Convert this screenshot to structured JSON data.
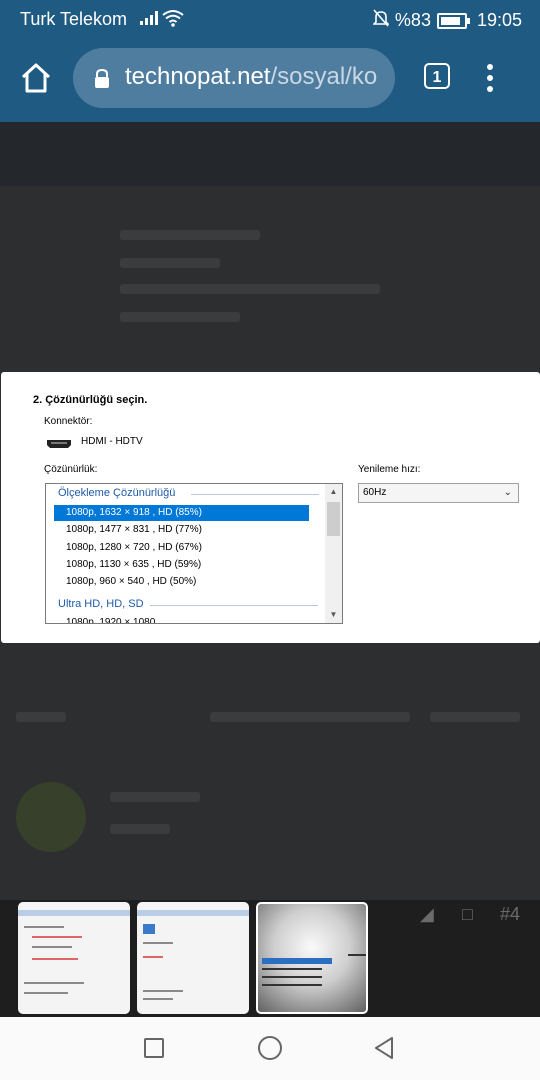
{
  "status_bar": {
    "carrier": "Turk Telekom",
    "battery": "%83",
    "time": "19:05"
  },
  "browser": {
    "url_domain": "technopat.net",
    "url_path": "/sosyal/ko",
    "tab_count": "1"
  },
  "dialog": {
    "title": "2. Çözünürlüğü seçin.",
    "connector_label": "Konnektör:",
    "connector_value": "HDMI - HDTV",
    "resolution_label": "Çözünürlük:",
    "refresh_label": "Yenileme hızı:",
    "refresh_value": "60Hz",
    "group_scaling": "Ölçekleme Çözünürlüğü",
    "items": [
      "1080p, 1632 × 918 , HD (85%)",
      "1080p, 1477 × 831 , HD (77%)",
      "1080p, 1280 × 720 , HD (67%)",
      "1080p, 1130 × 635 , HD (59%)",
      "1080p, 960 × 540 , HD (50%)"
    ],
    "selected_index": 0,
    "group_ultra": "Ultra HD, HD, SD",
    "partial_item": "1080p, 1920 × 1080"
  },
  "thumbnails": {
    "count": 3,
    "active_index": 2
  },
  "background_page": {
    "post_number": "#4"
  }
}
